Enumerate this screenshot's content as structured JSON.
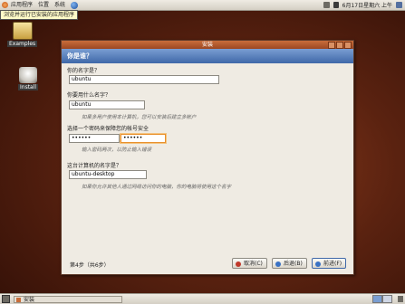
{
  "top_panel": {
    "menus": [
      "应用程序",
      "位置",
      "系统"
    ],
    "clock": "6月17日星期六 上午"
  },
  "tooltip": "浏览并运行已安装的应用程序",
  "desktop_icons": {
    "examples": "Examples",
    "install": "Install"
  },
  "window": {
    "title": "安装",
    "header": "你是谁？",
    "name_label": "你的名字是？",
    "name_value": "ubuntu",
    "login_label": "你要用什么名字？",
    "login_value": "ubuntu",
    "login_hint": "如果多用户使用本计算机，您可以安装后建立多帐户",
    "password_label": "选择一个密码来保障您的帐号安全",
    "password_value": "••••••",
    "password_confirm_value": "••••••",
    "password_hint": "输入密码两次，以防止输入错误",
    "hostname_label": "这台计算机的名字是？",
    "hostname_value": "ubuntu-desktop",
    "hostname_hint": "如果你允许其他人通过网络访问你的电脑，你的电脑将使用这个名字",
    "step": "第4步（共6步）",
    "cancel_label": "取消(C)",
    "back_label": "后退(B)",
    "forward_label": "前进(F)"
  },
  "bottom_panel": {
    "task_label": "安装"
  }
}
